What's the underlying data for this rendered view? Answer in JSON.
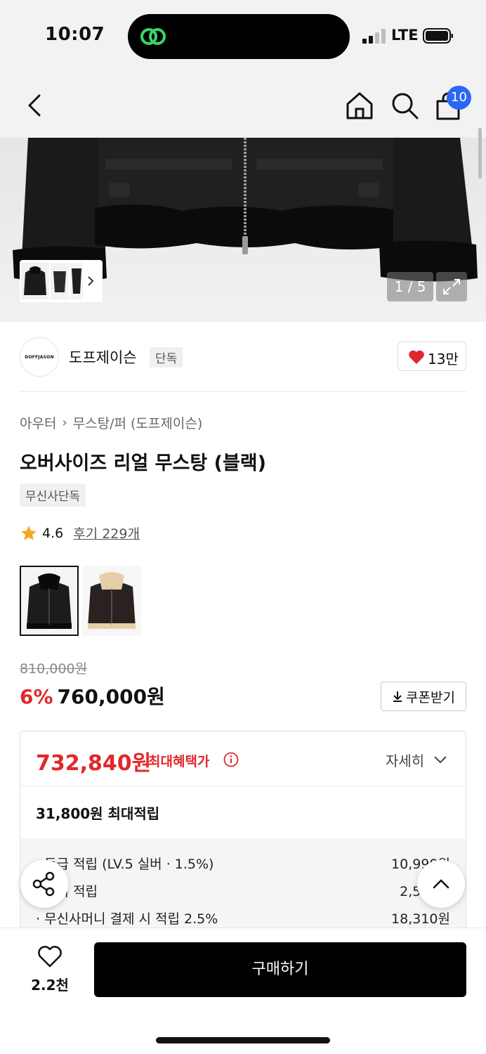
{
  "status_bar": {
    "time": "10:07",
    "network": "LTE"
  },
  "header": {
    "cart_count": "10"
  },
  "gallery": {
    "counter": "1 / 5"
  },
  "brand": {
    "logo_text": "DOFFJASON",
    "name": "도프제이슨",
    "exclusive_label": "단독",
    "like_count": "13만"
  },
  "breadcrumb": {
    "category": "아우터",
    "subcategory": "무스탕/퍼 (도프제이슨)"
  },
  "product": {
    "title": "오버사이즈 리얼 무스탕 (블랙)",
    "tag": "무신사단독",
    "rating": "4.6",
    "review_label": "후기 229개"
  },
  "price": {
    "original": "810,000원",
    "discount": "6%",
    "sale": "760,000원",
    "coupon_label": "쿠폰받기"
  },
  "benefit": {
    "max_price": "732,840원",
    "max_label": "최대혜택가",
    "detail_label": "자세히",
    "points_summary": "31,800원 최대적립",
    "rows": [
      {
        "label": "· 등급 적립 (LV.5 실버 · 1.5%)",
        "value": "10,990원"
      },
      {
        "label": "· 후기 적립",
        "value": "2,500원"
      },
      {
        "label": "· 무신사머니 결제 시 적립 2.5%",
        "value": "18,310원"
      }
    ]
  },
  "bottom": {
    "wish_count": "2.2천",
    "buy_label": "구매하기"
  },
  "colors": {
    "accent_red": "#e0282b",
    "badge_blue": "#2b66f6",
    "star": "#f5a623"
  }
}
